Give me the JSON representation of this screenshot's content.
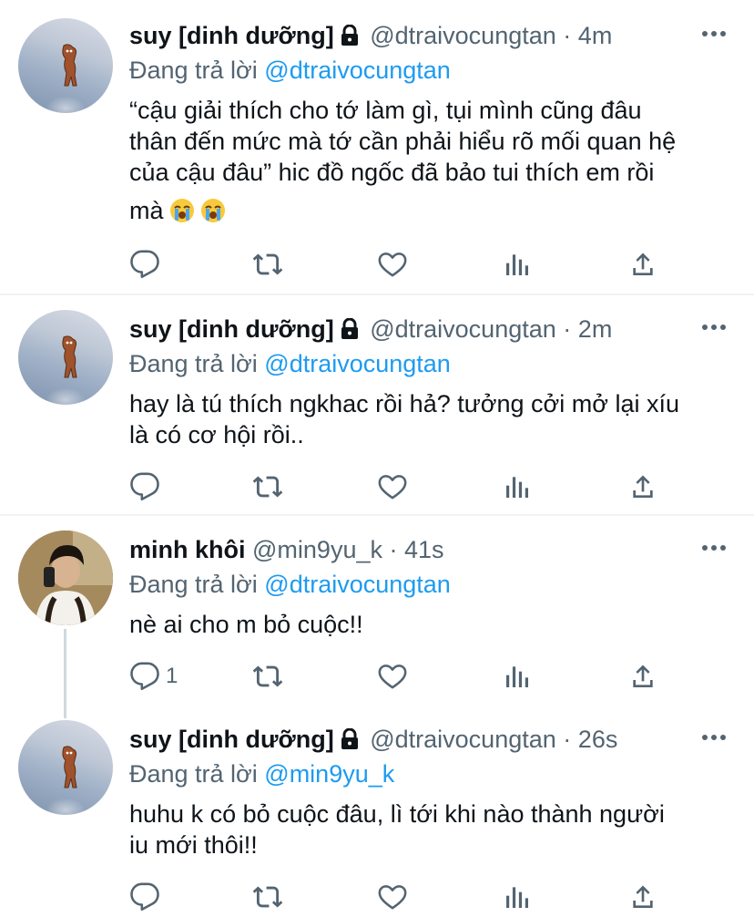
{
  "colors": {
    "accent": "#1d9bf0",
    "muted": "#536471",
    "text": "#0f1419"
  },
  "tweets": [
    {
      "name": "suy [dinh dưỡng]",
      "handle": "@dtraivocungtan",
      "time": "4m",
      "reply_prefix": "Đang trả lời",
      "reply_to": "@dtraivocungtan",
      "text_lines": [
        "“cậu giải thích cho tớ làm gì, tụi mình cũng đâu",
        "thân đến mức mà tớ cần phải hiểu rõ mối quan hệ",
        "của cậu đâu” hic đồ ngốc đã bảo tui thích em rồi",
        "mà"
      ],
      "emojis": [
        "crying-face",
        "crying-face"
      ],
      "reply_count": ""
    },
    {
      "name": "suy [dinh dưỡng]",
      "handle": "@dtraivocungtan",
      "time": "2m",
      "reply_prefix": "Đang trả lời",
      "reply_to": "@dtraivocungtan",
      "text_lines": [
        "hay là tú thích ngkhac rồi hả? tưởng cởi mở lại xíu",
        "là có cơ hội rồi.."
      ],
      "reply_count": ""
    },
    {
      "name": "minh khôi",
      "handle": "@min9yu_k",
      "time": "41s",
      "reply_prefix": "Đang trả lời",
      "reply_to": "@dtraivocungtan",
      "text_lines": [
        "nè ai cho m bỏ cuộc!!"
      ],
      "reply_count": "1"
    },
    {
      "name": "suy [dinh dưỡng]",
      "handle": "@dtraivocungtan",
      "time": "26s",
      "reply_prefix": "Đang trả lời",
      "reply_to": "@min9yu_k",
      "text_lines": [
        "huhu k có bỏ cuộc đâu, lì tới khi nào thành người",
        "iu mới thôi!!"
      ],
      "reply_count": ""
    }
  ],
  "separator": "·"
}
